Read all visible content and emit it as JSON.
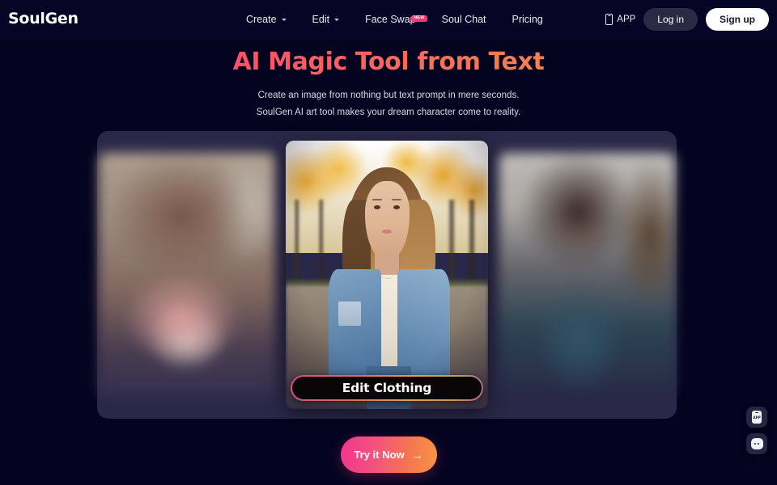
{
  "brand": {
    "name": "SoulGen"
  },
  "nav": {
    "items": [
      {
        "label": "Create",
        "has_caret": true,
        "badge": null
      },
      {
        "label": "Edit",
        "has_caret": true,
        "badge": null
      },
      {
        "label": "Face Swap",
        "has_caret": false,
        "badge": "NEW"
      },
      {
        "label": "Soul Chat",
        "has_caret": false,
        "badge": null
      },
      {
        "label": "Pricing",
        "has_caret": false,
        "badge": null
      }
    ],
    "app_label": "APP",
    "login_label": "Log in",
    "signup_label": "Sign up"
  },
  "hero": {
    "title": "AI Magic Tool from Text",
    "subtitle_line1": "Create an image from nothing but text prompt in mere seconds.",
    "subtitle_line2": "SoulGen AI art tool makes your dream character come to reality."
  },
  "carousel": {
    "slides": [
      {
        "position": "left",
        "alt": "blurred portrait of woman in pink top",
        "active": false
      },
      {
        "position": "center",
        "alt": "woman in denim jacket in autumn park",
        "active": true
      },
      {
        "position": "right",
        "alt": "blurred portrait of woman in teal top",
        "active": false
      }
    ],
    "center_overlay_label": "Edit Clothing"
  },
  "cta": {
    "label": "Try it Now",
    "arrow": "→"
  },
  "floating": {
    "app_button_label": "APP",
    "chat_button_label": "Chat"
  },
  "colors": {
    "page_background": "#050420",
    "nav_background": "#060525",
    "carousel_background": "#2a2848",
    "accent_pink": "#f2368f",
    "accent_orange": "#f79445",
    "badge_pink": "#ff2d6e",
    "signup_white": "#ffffff",
    "login_grey": "#2b2a45"
  }
}
